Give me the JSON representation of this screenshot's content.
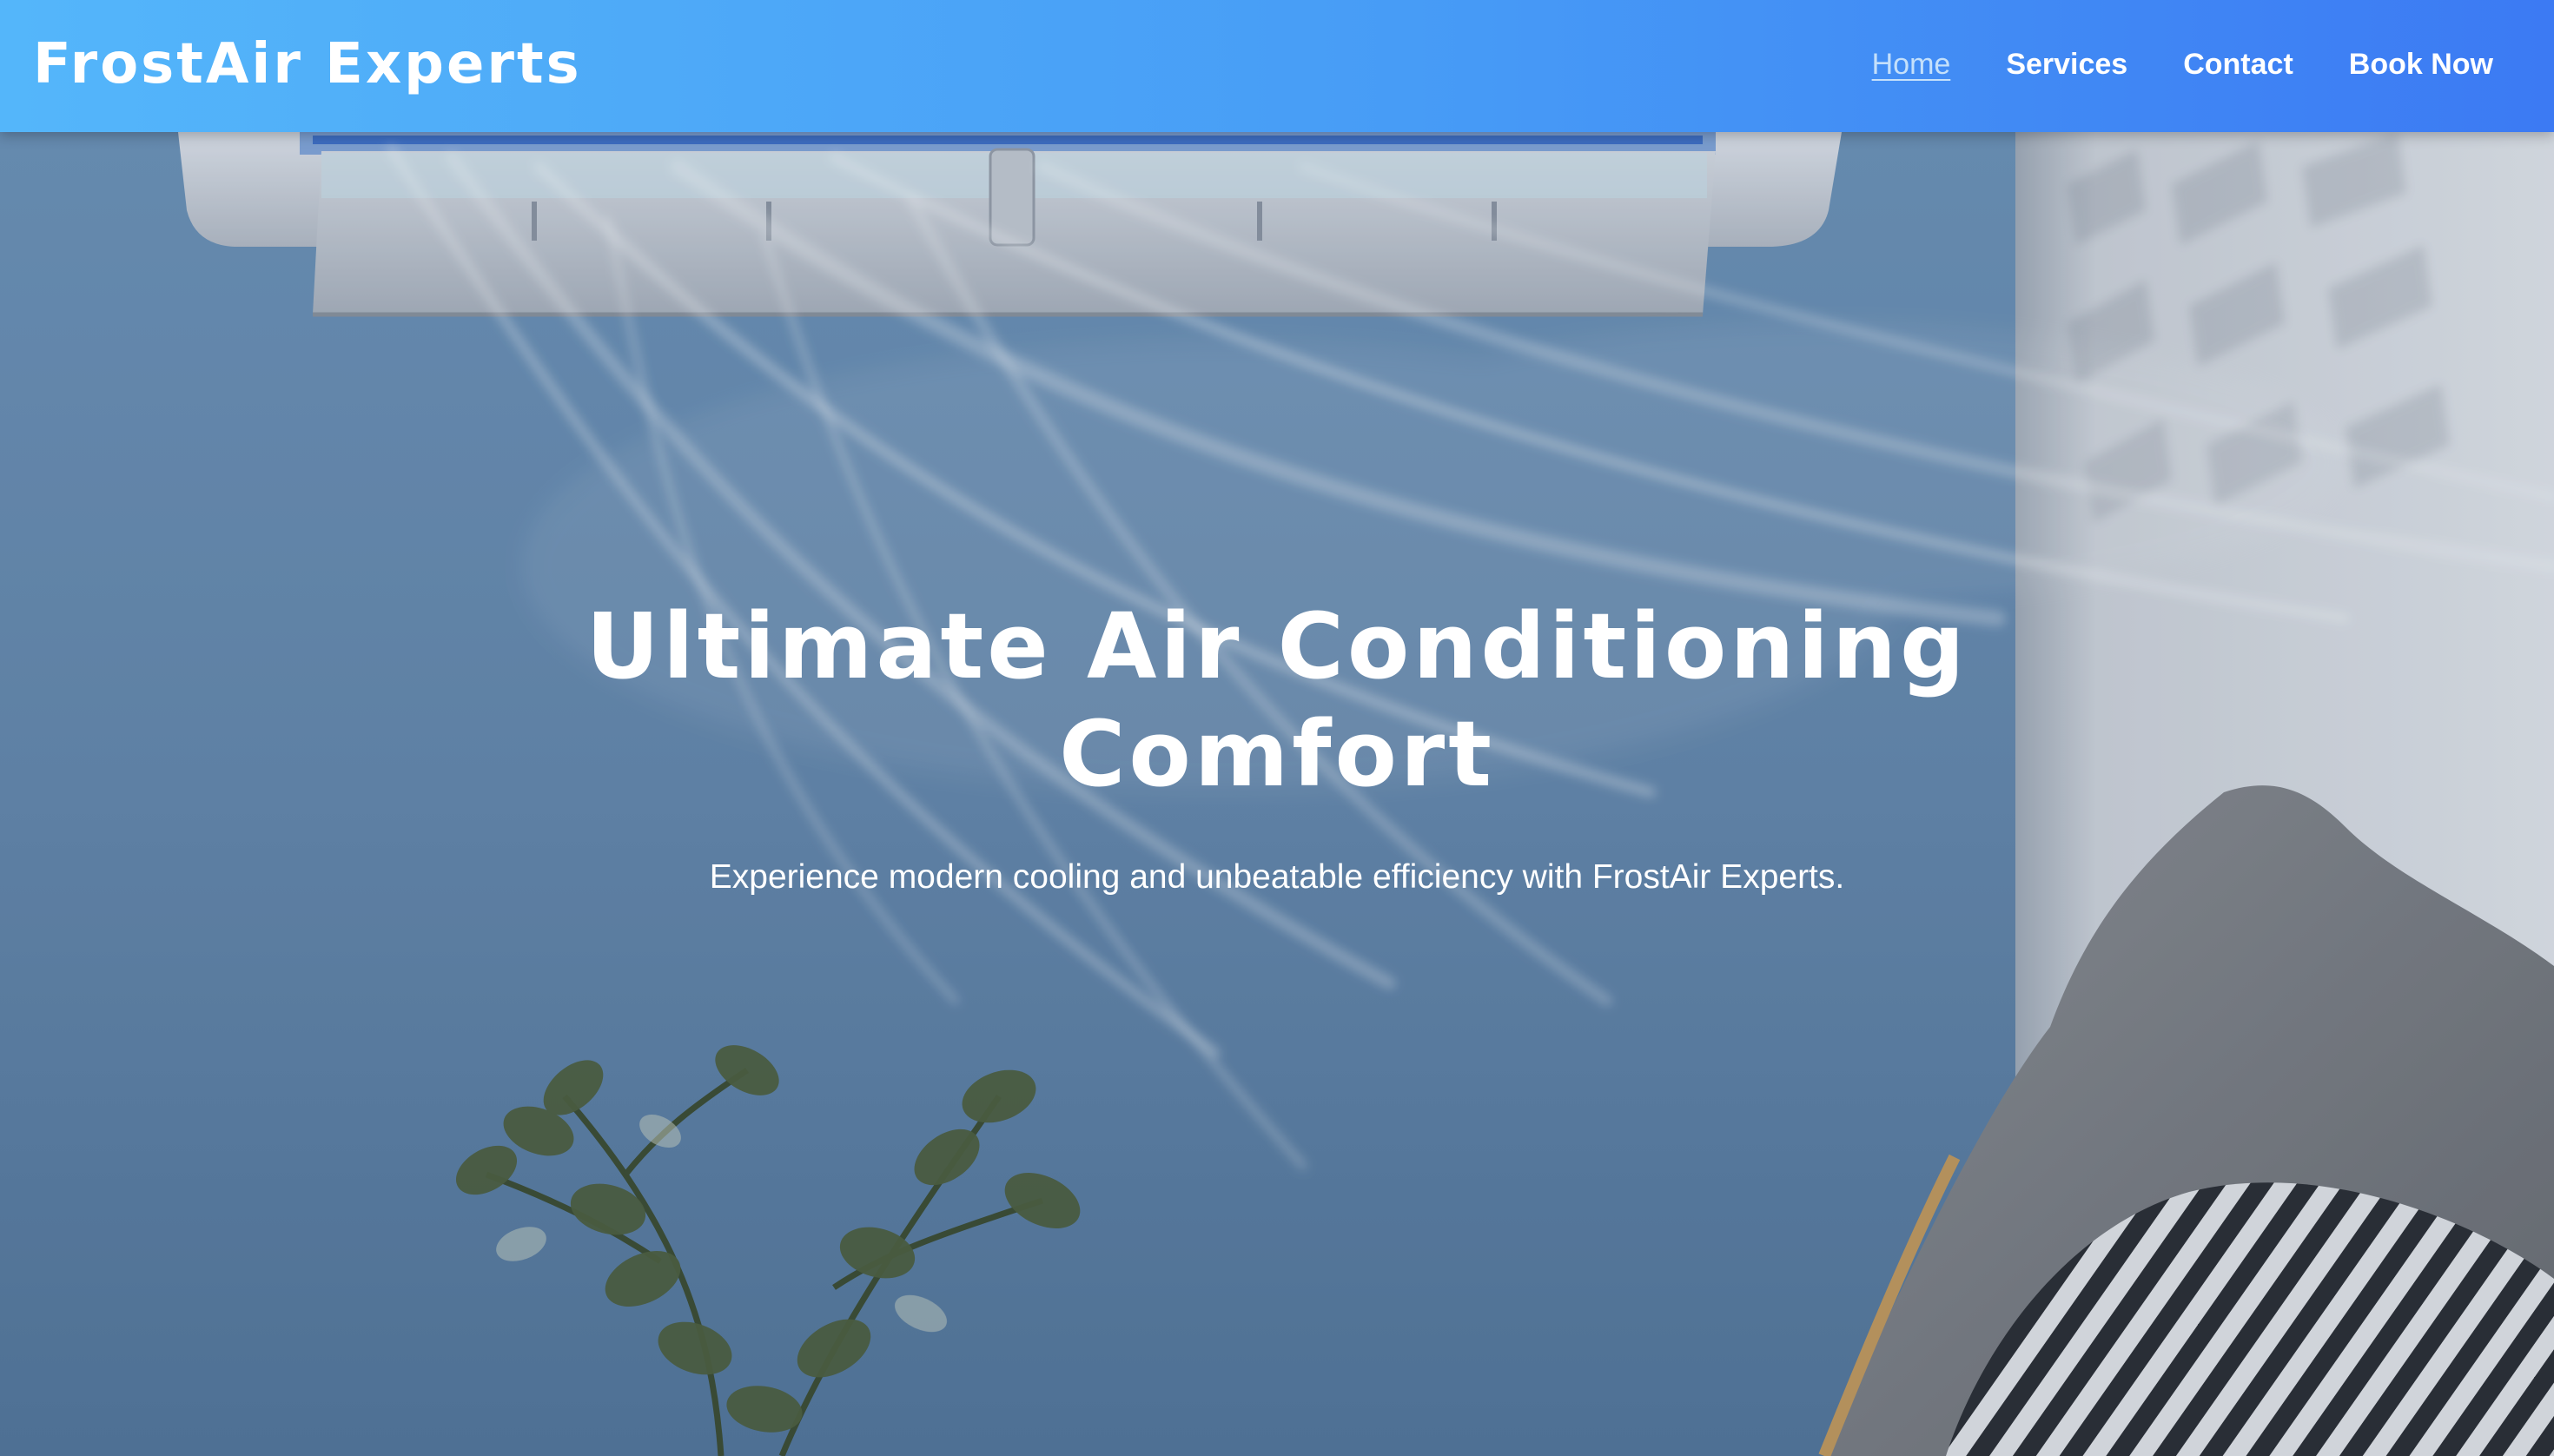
{
  "brand": {
    "logo_text": "FrostAir Experts",
    "header_gradient": [
      "#54b6fa",
      "#3c7af3"
    ]
  },
  "nav": {
    "items": [
      {
        "label": "Home",
        "active": true
      },
      {
        "label": "Services",
        "active": false
      },
      {
        "label": "Contact",
        "active": false
      },
      {
        "label": "Book Now",
        "active": false
      }
    ]
  },
  "hero": {
    "title": "Ultimate Air Conditioning Comfort",
    "subtitle": "Experience modern cooling and unbeatable efficiency with FrostAir Experts.",
    "image_description_icon": "air-conditioner-illustration"
  }
}
